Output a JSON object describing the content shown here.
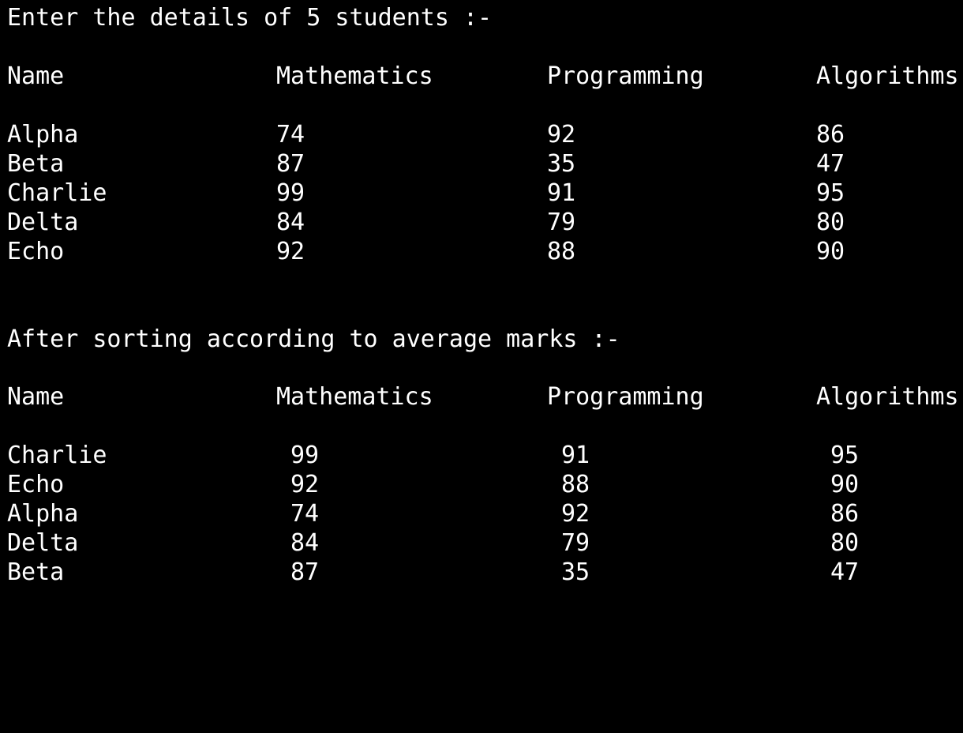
{
  "colors": {
    "background": "#000000",
    "text": "#ffffff"
  },
  "input_section": {
    "prompt": "Enter the details of 5 students :-",
    "headers": [
      "Name",
      "Mathematics",
      "Programming",
      "Algorithms"
    ],
    "rows": [
      {
        "name": "Alpha",
        "mathematics": "74",
        "programming": "92",
        "algorithms": "86"
      },
      {
        "name": "Beta",
        "mathematics": "87",
        "programming": "35",
        "algorithms": "47"
      },
      {
        "name": "Charlie",
        "mathematics": "99",
        "programming": "91",
        "algorithms": "95"
      },
      {
        "name": "Delta",
        "mathematics": "84",
        "programming": "79",
        "algorithms": "80"
      },
      {
        "name": "Echo",
        "mathematics": "92",
        "programming": "88",
        "algorithms": "90"
      }
    ]
  },
  "sorted_section": {
    "heading": "After sorting according to average marks :-",
    "headers": [
      "Name",
      "Mathematics",
      "Programming",
      "Algorithms"
    ],
    "rows": [
      {
        "name": "Charlie",
        "mathematics": "99",
        "programming": "91",
        "algorithms": "95"
      },
      {
        "name": "Echo",
        "mathematics": "92",
        "programming": "88",
        "algorithms": "90"
      },
      {
        "name": "Alpha",
        "mathematics": "74",
        "programming": "92",
        "algorithms": "86"
      },
      {
        "name": "Delta",
        "mathematics": "84",
        "programming": "79",
        "algorithms": "80"
      },
      {
        "name": "Beta",
        "mathematics": "87",
        "programming": "35",
        "algorithms": "47"
      }
    ]
  }
}
